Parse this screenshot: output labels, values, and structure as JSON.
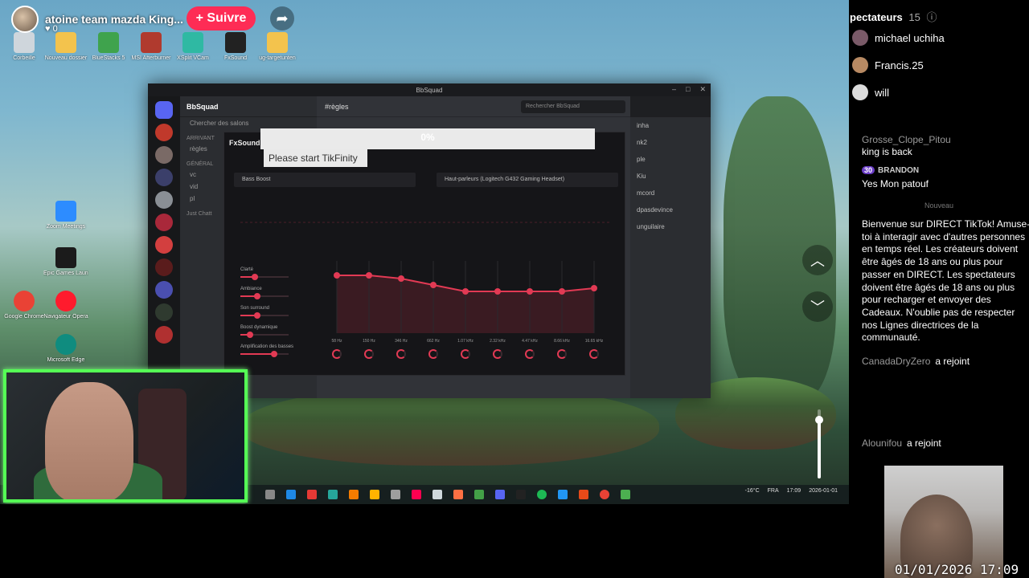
{
  "stream": {
    "streamer_name": "atoine team mazda King...",
    "likes": "0",
    "follow_label": "+ Suivre",
    "share_icon": "share-icon",
    "scroll_up_icon": "chevron-up-icon",
    "scroll_down_icon": "chevron-down-icon",
    "volume_level": 0.85
  },
  "desktop": {
    "icons": [
      {
        "label": "Corbeille",
        "color": "#cfd6dc"
      },
      {
        "label": "Nouveau dossier",
        "color": "#f3c34d"
      },
      {
        "label": "BlueStacks 5",
        "color": "#3fa34d"
      },
      {
        "label": "MSI Afterburner",
        "color": "#b03a2e"
      },
      {
        "label": "XSplit VCam",
        "color": "#2fb9a3"
      },
      {
        "label": "FxSound",
        "color": "#222222"
      },
      {
        "label": "ug-targetunten",
        "color": "#f3c34d"
      },
      {
        "label": "Zoom Meetings",
        "color": "#2d8cff"
      },
      {
        "label": "Google Chrome",
        "color": "#e94235"
      },
      {
        "label": "Epic Games Launcher",
        "color": "#1b1b1b"
      },
      {
        "label": "Navigateur Opera",
        "color": "#ff1b2d"
      },
      {
        "label": "Microsoft Edge",
        "color": "#0f8c7f"
      }
    ]
  },
  "discord": {
    "window_title": "BbSquad",
    "server_name": "BbSquad",
    "search_placeholder": "Chercher des salons",
    "channel_header": "règles",
    "chat_search": "Rechercher BbSquad",
    "categories": [
      "ARRIVANT",
      "GÉNÉRAL"
    ],
    "channels": [
      "règles",
      "vc",
      "vid",
      "pl",
      "Just Chatt"
    ],
    "members": [
      "inha",
      "nk2",
      "ple",
      "Kiu",
      "mcord",
      "dpasdevince",
      "unguilaire"
    ]
  },
  "fxsound": {
    "title": "FxSound",
    "preset": "Bass Boost",
    "output_device": "Haut-parleurs (Logitech G432 Gaming Headset)",
    "effects": [
      {
        "label": "Clarté",
        "value": 0.3
      },
      {
        "label": "Ambiance",
        "value": 0.35
      },
      {
        "label": "Son surround",
        "value": 0.35
      },
      {
        "label": "Boost dynamique",
        "value": 0.2
      },
      {
        "label": "Amplification des basses",
        "value": 0.7
      }
    ],
    "eq_bands": [
      {
        "label": "58 Hz",
        "level": 0.9
      },
      {
        "label": "150 Hz",
        "level": 0.9
      },
      {
        "label": "346 Hz",
        "level": 0.85
      },
      {
        "label": "662 Hz",
        "level": 0.75
      },
      {
        "label": "1.07 kHz",
        "level": 0.65
      },
      {
        "label": "2.32 kHz",
        "level": 0.65
      },
      {
        "label": "4.47 kHz",
        "level": 0.65
      },
      {
        "label": "8.66 kHz",
        "level": 0.65
      },
      {
        "label": "16.65 kHz",
        "level": 0.7
      }
    ]
  },
  "tikfinity": {
    "progress_text": "0%",
    "progress_value": 0.0,
    "prompt": "Please start TikFinity"
  },
  "taskbar": {
    "weather": "-16°C",
    "language": "FRA",
    "time": "17:09",
    "date": "2026-01-01"
  },
  "chat": {
    "viewers_label": "pectateurs",
    "viewer_count": "15",
    "top_viewers": [
      {
        "name": "michael uchiha",
        "color": "#7a5a68"
      },
      {
        "name": "Francis.25",
        "color": "#b88a63"
      },
      {
        "name": "will",
        "color": "#dcdcdc"
      }
    ],
    "messages": [
      {
        "user": "Grosse_Clope_Pitou",
        "text": "king is back"
      },
      {
        "user": "BRANDON",
        "level": "30",
        "text": "Yes Mon patouf"
      }
    ],
    "new_divider": "Nouveau",
    "notice": "Bienvenue sur DIRECT TikTok! Amuse-toi à interagir avec d'autres personnes en temps réel. Les créateurs doivent être âgés de 18 ans ou plus pour passer en DIRECT. Les spectateurs doivent être âgés de 18 ans ou plus pour recharger et envoyer des Cadeaux. N'oublie pas de respecter nos Lignes directrices de la communauté.",
    "joins": [
      {
        "user": "CanadaDryZero",
        "action": "a rejoint"
      },
      {
        "user": "Alounifou",
        "action": "a rejoint"
      }
    ]
  },
  "overlay_clock": "01/01/2026 17:09"
}
